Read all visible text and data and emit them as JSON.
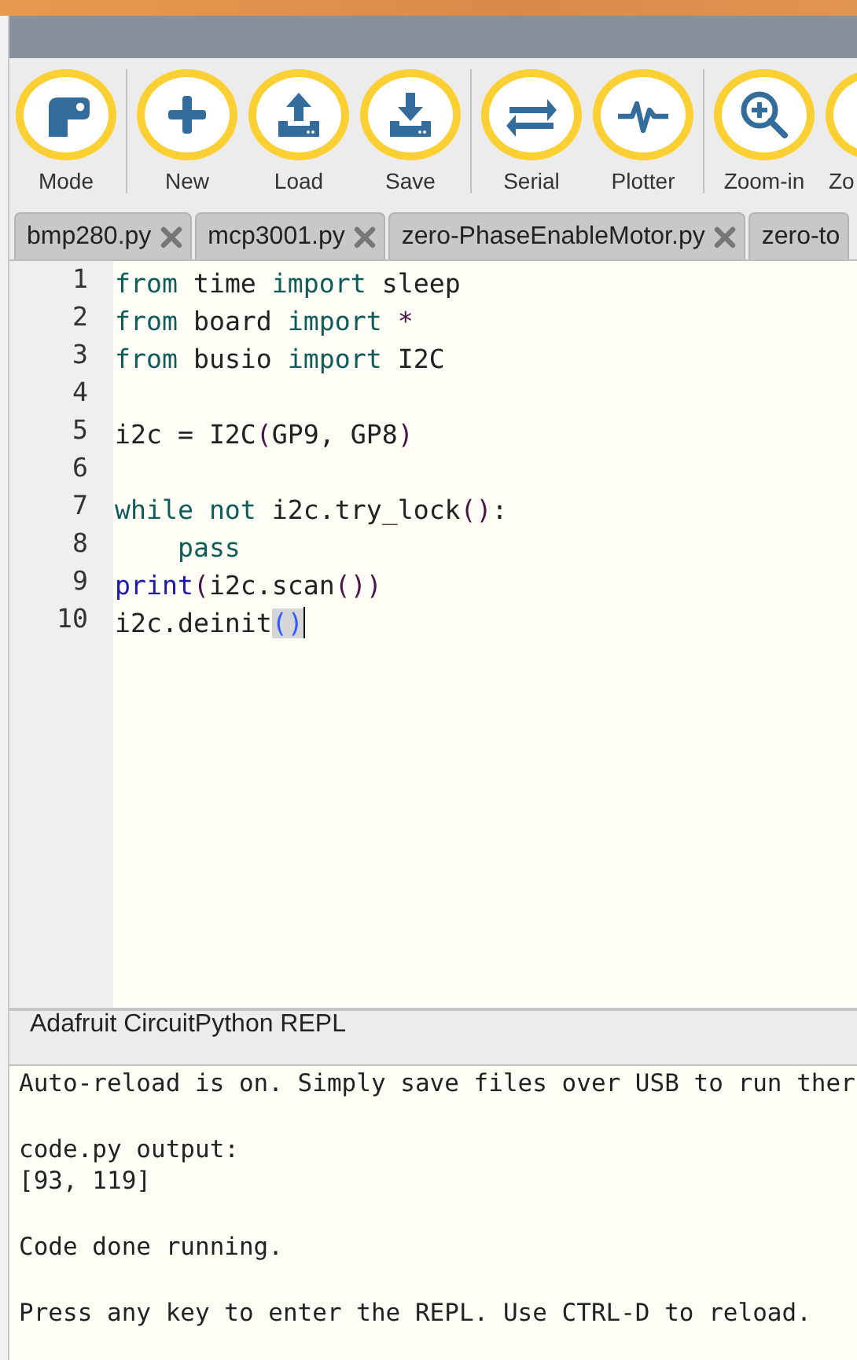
{
  "toolbar": {
    "groups": [
      [
        {
          "label": "Mode",
          "kind": "mode"
        }
      ],
      [
        {
          "label": "New",
          "kind": "new"
        },
        {
          "label": "Load",
          "kind": "load"
        },
        {
          "label": "Save",
          "kind": "save"
        }
      ],
      [
        {
          "label": "Serial",
          "kind": "serial"
        },
        {
          "label": "Plotter",
          "kind": "plotter"
        }
      ],
      [
        {
          "label": "Zoom-in",
          "kind": "zoom-in"
        },
        {
          "label": "Zo"
        }
      ]
    ]
  },
  "tabs": [
    {
      "label": "bmp280.py",
      "selected": false,
      "closable": true
    },
    {
      "label": "mcp3001.py",
      "selected": false,
      "closable": true
    },
    {
      "label": "zero-PhaseEnableMotor.py",
      "selected": false,
      "closable": true
    },
    {
      "label": "zero-to",
      "selected": false,
      "closable": false
    }
  ],
  "editor": {
    "lines": [
      {
        "number": "1",
        "cursor": false,
        "tokens": [
          {
            "kind": "keyword",
            "text": "from"
          },
          {
            "kind": "plain",
            "text": " time "
          },
          {
            "kind": "keyword",
            "text": "import"
          },
          {
            "kind": "plain",
            "text": " sleep"
          }
        ]
      },
      {
        "number": "2",
        "cursor": false,
        "tokens": [
          {
            "kind": "keyword",
            "text": "from"
          },
          {
            "kind": "plain",
            "text": " board "
          },
          {
            "kind": "keyword",
            "text": "import"
          },
          {
            "kind": "operator",
            "text": " *"
          }
        ]
      },
      {
        "number": "3",
        "cursor": false,
        "tokens": [
          {
            "kind": "keyword",
            "text": "from"
          },
          {
            "kind": "plain",
            "text": " busio "
          },
          {
            "kind": "keyword",
            "text": "import"
          },
          {
            "kind": "plain",
            "text": " I2C"
          }
        ]
      },
      {
        "number": "4",
        "cursor": false
      },
      {
        "number": "5",
        "cursor": false,
        "tokens": [
          {
            "kind": "plain",
            "text": "i2c = I2C"
          },
          {
            "kind": "paren",
            "text": "("
          },
          {
            "kind": "plain",
            "text": "GP9, GP8"
          },
          {
            "kind": "paren",
            "text": ")"
          }
        ]
      },
      {
        "number": "6",
        "cursor": false
      },
      {
        "number": "7",
        "cursor": false,
        "tokens": [
          {
            "kind": "keyword",
            "text": "while not"
          },
          {
            "kind": "plain",
            "text": " i2c.try_lock"
          },
          {
            "kind": "paren",
            "text": "()"
          },
          {
            "kind": "plain",
            "text": ":"
          }
        ]
      },
      {
        "number": "8",
        "cursor": false,
        "tokens": [
          {
            "kind": "keyword",
            "text": "    pass"
          }
        ]
      },
      {
        "number": "9",
        "cursor": false,
        "tokens": [
          {
            "kind": "builtin",
            "text": "print"
          },
          {
            "kind": "paren",
            "text": "("
          },
          {
            "kind": "plain",
            "text": "i2c.scan"
          },
          {
            "kind": "paren",
            "text": "())"
          }
        ]
      },
      {
        "number": "10",
        "cursor": true,
        "tokens": [
          {
            "kind": "plain",
            "text": "i2c.deinit"
          },
          {
            "kind": "match",
            "text": "()"
          }
        ]
      }
    ]
  },
  "repl": {
    "title": "Adafruit CircuitPython REPL",
    "blocks": [
      [
        "Auto-reload is on. Simply save files over USB to run ther"
      ],
      [
        "code.py output:",
        "[93, 119]"
      ],
      [
        "Code done running."
      ],
      [
        "Press any key to enter the REPL. Use CTRL-D to reload."
      ]
    ]
  }
}
